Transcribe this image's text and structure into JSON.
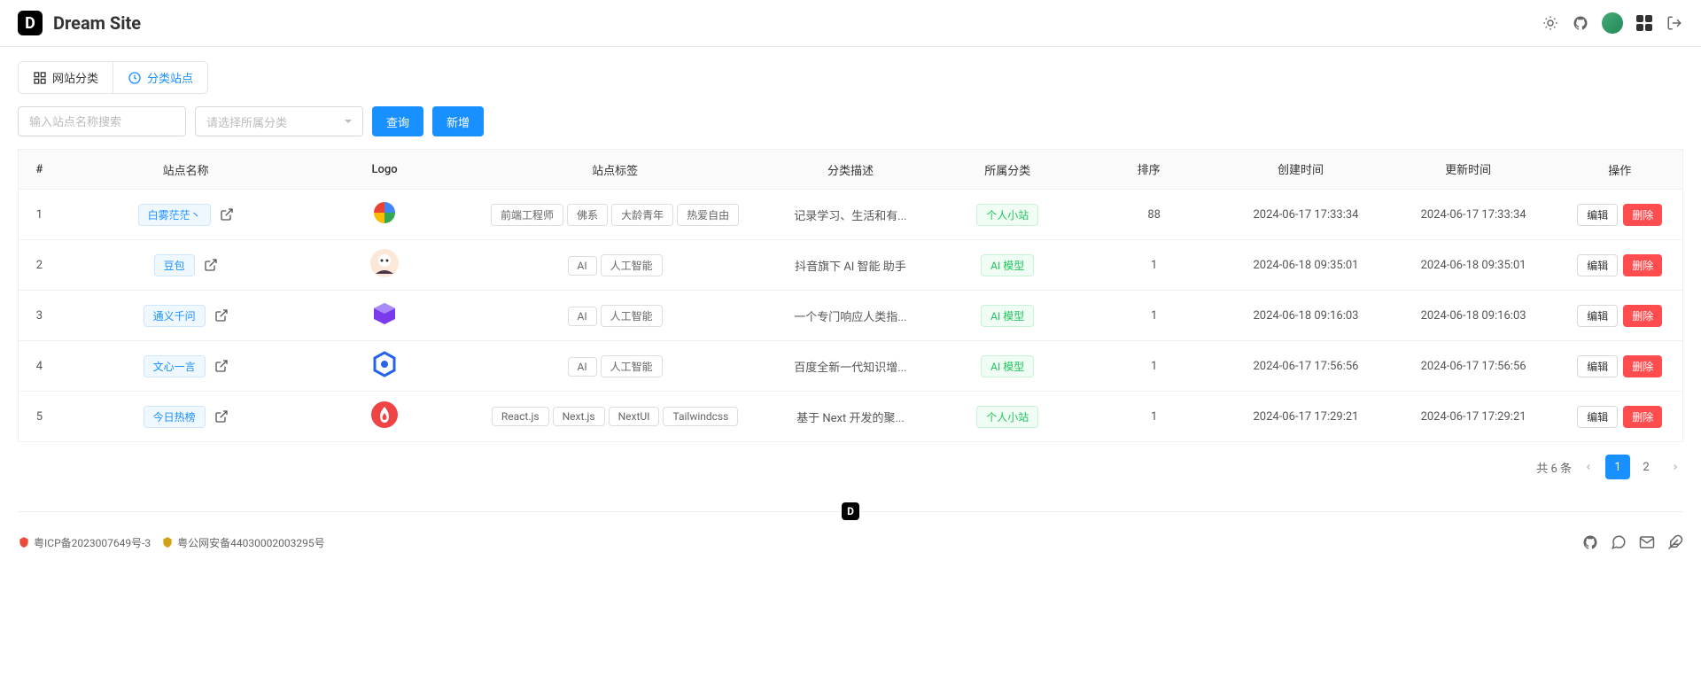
{
  "header": {
    "title": "Dream Site",
    "logo_letter": "D"
  },
  "tabs": [
    {
      "label": "网站分类",
      "active": false
    },
    {
      "label": "分类站点",
      "active": true
    }
  ],
  "filters": {
    "search_placeholder": "输入站点名称搜索",
    "category_placeholder": "请选择所属分类",
    "query_btn": "查询",
    "new_btn": "新增"
  },
  "table": {
    "headers": {
      "idx": "#",
      "name": "站点名称",
      "logo": "Logo",
      "tags": "站点标签",
      "desc": "分类描述",
      "category": "所属分类",
      "sort": "排序",
      "created": "创建时间",
      "updated": "更新时间",
      "actions": "操作"
    },
    "rows": [
      {
        "idx": "1",
        "name": "白雾茫茫丶",
        "logo_type": "pinwheel",
        "tags": [
          "前端工程师",
          "佛系",
          "大龄青年",
          "热爱自由"
        ],
        "desc": "记录学习、生活和有...",
        "category": "个人小站",
        "sort": "88",
        "created": "2024-06-17 17:33:34",
        "updated": "2024-06-17 17:33:34"
      },
      {
        "idx": "2",
        "name": "豆包",
        "logo_type": "avatar",
        "tags": [
          "AI",
          "人工智能"
        ],
        "desc": "抖音旗下 AI 智能 助手",
        "category": "AI 模型",
        "sort": "1",
        "created": "2024-06-18 09:35:01",
        "updated": "2024-06-18 09:35:01"
      },
      {
        "idx": "3",
        "name": "通义千问",
        "logo_type": "purple-cube",
        "tags": [
          "AI",
          "人工智能"
        ],
        "desc": "一个专门响应人类指...",
        "category": "AI 模型",
        "sort": "1",
        "created": "2024-06-18 09:16:03",
        "updated": "2024-06-18 09:16:03"
      },
      {
        "idx": "4",
        "name": "文心一言",
        "logo_type": "blue-hex",
        "tags": [
          "AI",
          "人工智能"
        ],
        "desc": "百度全新一代知识增...",
        "category": "AI 模型",
        "sort": "1",
        "created": "2024-06-17 17:56:56",
        "updated": "2024-06-17 17:56:56"
      },
      {
        "idx": "5",
        "name": "今日热榜",
        "logo_type": "fire",
        "tags": [
          "React.js",
          "Next.js",
          "NextUI",
          "Tailwindcss"
        ],
        "desc": "基于 Next 开发的聚...",
        "category": "个人小站",
        "sort": "1",
        "created": "2024-06-17 17:29:21",
        "updated": "2024-06-17 17:29:21"
      }
    ],
    "action_labels": {
      "edit": "编辑",
      "delete": "删除"
    }
  },
  "pagination": {
    "total_text": "共 6 条",
    "pages": [
      "1",
      "2"
    ],
    "active": "1"
  },
  "footer": {
    "divider_letter": "D",
    "icp": "粤ICP备2023007649号-3",
    "gongan": "粤公网安备44030002003295号"
  }
}
